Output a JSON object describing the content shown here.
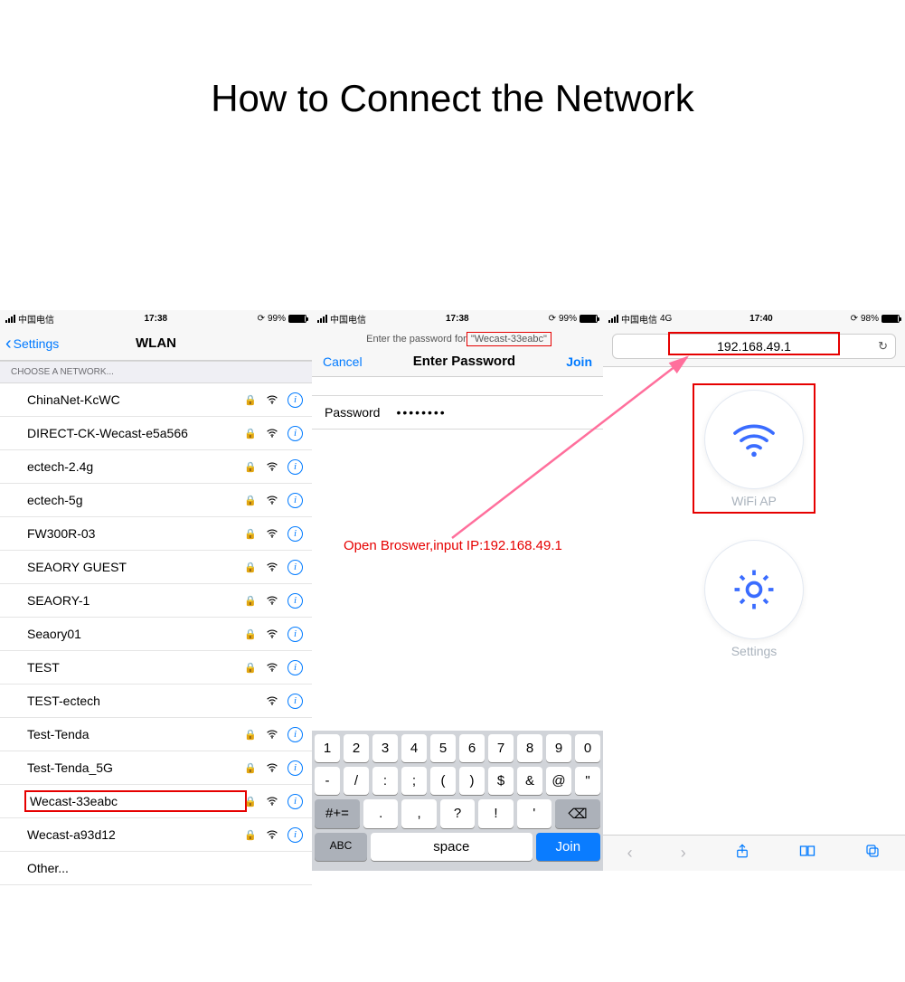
{
  "title": "How to Connect the Network",
  "annotation": "Open Broswer,input IP:192.168.49.1",
  "phone1": {
    "status": {
      "carrier": "中国电信",
      "time": "17:38",
      "battery": "99%"
    },
    "back": "Settings",
    "title": "WLAN",
    "section": "CHOOSE A NETWORK...",
    "networks": [
      {
        "name": "ChinaNet-KcWC",
        "locked": true
      },
      {
        "name": "DIRECT-CK-Wecast-e5a566",
        "locked": true
      },
      {
        "name": "ectech-2.4g",
        "locked": true
      },
      {
        "name": "ectech-5g",
        "locked": true
      },
      {
        "name": "FW300R-03",
        "locked": true
      },
      {
        "name": "SEAORY GUEST",
        "locked": true
      },
      {
        "name": "SEAORY-1",
        "locked": true
      },
      {
        "name": "Seaory01",
        "locked": true
      },
      {
        "name": "TEST",
        "locked": true
      },
      {
        "name": "TEST-ectech",
        "locked": false
      },
      {
        "name": "Test-Tenda",
        "locked": true
      },
      {
        "name": "Test-Tenda_5G",
        "locked": true
      },
      {
        "name": "Wecast-33eabc",
        "locked": true,
        "highlight": true
      },
      {
        "name": "Wecast-a93d12",
        "locked": true
      },
      {
        "name": "Other...",
        "locked": false,
        "other": true
      }
    ]
  },
  "phone2": {
    "status": {
      "carrier": "中国电信",
      "time": "17:38",
      "battery": "99%"
    },
    "prompt_prefix": "Enter the password for ",
    "prompt_ssid": "\"Wecast-33eabc\"",
    "cancel": "Cancel",
    "title": "Enter Password",
    "join": "Join",
    "pwd_label": "Password",
    "pwd_value": "••••••••",
    "kbd": {
      "r1": [
        "1",
        "2",
        "3",
        "4",
        "5",
        "6",
        "7",
        "8",
        "9",
        "0"
      ],
      "r2": [
        "-",
        "/",
        ":",
        ";",
        "(",
        ")",
        "$",
        "&",
        "@",
        "\""
      ],
      "r3_shift": "#+=",
      "r3": [
        ".",
        ",",
        "?",
        "!",
        "'"
      ],
      "r3_bksp": "⌫",
      "abc": "ABC",
      "space": "space",
      "joinkey": "Join"
    }
  },
  "phone3": {
    "status": {
      "carrier": "中国电信",
      "net": "4G",
      "time": "17:40",
      "battery": "98%"
    },
    "url": "192.168.49.1",
    "wifiap": "WiFi AP",
    "settings": "Settings"
  }
}
